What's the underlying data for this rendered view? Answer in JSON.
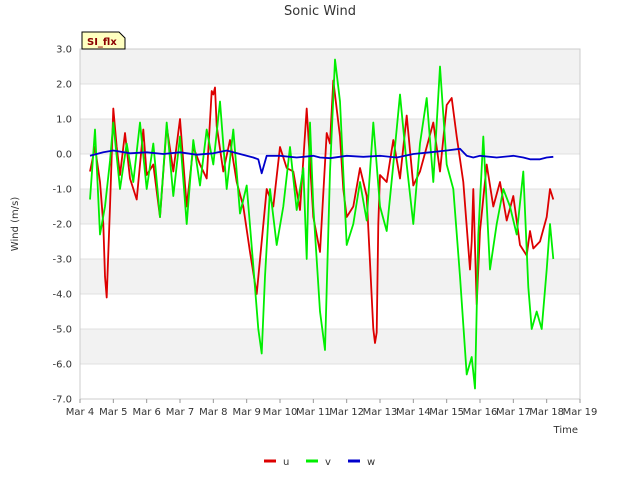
{
  "chart_data": {
    "type": "line",
    "title": "Sonic Wind",
    "xlabel": "Time",
    "ylabel": "Wind (m/s)",
    "badge": "SI_flx",
    "ylim": [
      -7.0,
      3.0
    ],
    "xlim": [
      0,
      15
    ],
    "grid": "horizontal bands",
    "legend_position": "bottom-center",
    "x_ticks": [
      {
        "v": 0,
        "label": "Mar 4"
      },
      {
        "v": 1,
        "label": "Mar 5"
      },
      {
        "v": 2,
        "label": "Mar 6"
      },
      {
        "v": 3,
        "label": "Mar 7"
      },
      {
        "v": 4,
        "label": "Mar 8"
      },
      {
        "v": 5,
        "label": "Mar 9"
      },
      {
        "v": 6,
        "label": "Mar 10"
      },
      {
        "v": 7,
        "label": "Mar 11"
      },
      {
        "v": 8,
        "label": "Mar 12"
      },
      {
        "v": 9,
        "label": "Mar 13"
      },
      {
        "v": 10,
        "label": "Mar 14"
      },
      {
        "v": 11,
        "label": "Mar 15"
      },
      {
        "v": 12,
        "label": "Mar 16"
      },
      {
        "v": 13,
        "label": "Mar 17"
      },
      {
        "v": 14,
        "label": "Mar 18"
      },
      {
        "v": 15,
        "label": "Mar 19"
      }
    ],
    "y_ticks": [
      {
        "v": 3,
        "label": "3.0"
      },
      {
        "v": 2,
        "label": "2.0"
      },
      {
        "v": 1,
        "label": "1.0"
      },
      {
        "v": 0,
        "label": "0.0"
      },
      {
        "v": -1,
        "label": "-1.0"
      },
      {
        "v": -2,
        "label": "-2.0"
      },
      {
        "v": -3,
        "label": "-3.0"
      },
      {
        "v": -4,
        "label": "-4.0"
      },
      {
        "v": -5,
        "label": "-5.0"
      },
      {
        "v": -6,
        "label": "-6.0"
      },
      {
        "v": -7,
        "label": "-7.0"
      }
    ],
    "series": [
      {
        "name": "u",
        "color": "#dd0000",
        "x": [
          0.3,
          0.45,
          0.6,
          0.7,
          0.75,
          0.8,
          0.9,
          1.0,
          1.1,
          1.2,
          1.35,
          1.5,
          1.7,
          1.9,
          2.0,
          2.2,
          2.4,
          2.6,
          2.8,
          3.0,
          3.2,
          3.4,
          3.6,
          3.8,
          3.95,
          4.0,
          4.05,
          4.1,
          4.3,
          4.5,
          4.7,
          4.9,
          5.1,
          5.3,
          5.45,
          5.6,
          5.8,
          6.0,
          6.2,
          6.4,
          6.6,
          6.8,
          7.0,
          7.2,
          7.4,
          7.5,
          7.6,
          7.8,
          7.9,
          8.0,
          8.2,
          8.4,
          8.6,
          8.8,
          8.85,
          8.9,
          8.95,
          9.0,
          9.2,
          9.4,
          9.6,
          9.8,
          10.0,
          10.2,
          10.4,
          10.6,
          10.8,
          11.0,
          11.15,
          11.3,
          11.5,
          11.7,
          11.75,
          11.8,
          11.9,
          12.0,
          12.2,
          12.4,
          12.6,
          12.8,
          13.0,
          13.2,
          13.4,
          13.5,
          13.6,
          13.8,
          14.0,
          14.1,
          14.2
        ],
        "y": [
          -0.5,
          0.2,
          -0.8,
          -2.0,
          -3.5,
          -4.1,
          -1.5,
          1.3,
          0.2,
          -0.6,
          0.6,
          -0.7,
          -1.3,
          0.7,
          -0.6,
          -0.3,
          -1.8,
          0.8,
          -0.5,
          1.0,
          -1.5,
          0.2,
          -0.3,
          -0.7,
          1.8,
          1.7,
          1.9,
          0.8,
          -0.5,
          0.4,
          -0.8,
          -1.5,
          -2.8,
          -4.0,
          -2.5,
          -1.0,
          -1.5,
          0.2,
          -0.4,
          -0.5,
          -1.6,
          1.3,
          -1.8,
          -2.8,
          0.6,
          0.3,
          2.1,
          0.5,
          -1.0,
          -1.8,
          -1.5,
          -0.4,
          -1.2,
          -5.0,
          -5.4,
          -5.1,
          -2.0,
          -0.6,
          -0.8,
          0.4,
          -0.7,
          1.1,
          -0.9,
          -0.5,
          0.2,
          0.9,
          -0.5,
          1.4,
          1.6,
          0.5,
          -0.8,
          -3.3,
          -2.5,
          -1.0,
          -4.3,
          -2.2,
          -0.3,
          -1.5,
          -0.8,
          -1.9,
          -1.2,
          -2.6,
          -2.9,
          -2.2,
          -2.7,
          -2.5,
          -1.8,
          -1.0,
          -1.3
        ]
      },
      {
        "name": "v",
        "color": "#00ee00",
        "x": [
          0.3,
          0.45,
          0.6,
          0.75,
          0.9,
          1.0,
          1.2,
          1.4,
          1.6,
          1.8,
          2.0,
          2.2,
          2.4,
          2.6,
          2.8,
          3.0,
          3.2,
          3.4,
          3.6,
          3.8,
          4.0,
          4.2,
          4.4,
          4.6,
          4.8,
          5.0,
          5.2,
          5.35,
          5.45,
          5.55,
          5.7,
          5.9,
          6.1,
          6.3,
          6.5,
          6.7,
          6.8,
          6.9,
          7.0,
          7.2,
          7.35,
          7.5,
          7.65,
          7.8,
          8.0,
          8.2,
          8.4,
          8.6,
          8.8,
          9.0,
          9.2,
          9.4,
          9.6,
          9.8,
          10.0,
          10.2,
          10.4,
          10.6,
          10.8,
          11.0,
          11.2,
          11.4,
          11.6,
          11.75,
          11.85,
          11.95,
          12.1,
          12.3,
          12.5,
          12.7,
          12.9,
          13.1,
          13.3,
          13.45,
          13.55,
          13.7,
          13.85,
          14.0,
          14.1,
          14.2
        ],
        "y": [
          -1.3,
          0.7,
          -2.3,
          -1.5,
          -0.2,
          0.9,
          -1.0,
          0.3,
          -0.8,
          0.9,
          -1.0,
          0.3,
          -1.8,
          0.9,
          -1.2,
          0.5,
          -2.0,
          0.4,
          -0.9,
          0.7,
          -0.3,
          1.5,
          -1.0,
          0.7,
          -1.7,
          -0.9,
          -3.2,
          -5.0,
          -5.7,
          -3.5,
          -1.0,
          -2.6,
          -1.5,
          0.2,
          -1.6,
          -0.4,
          -3.0,
          0.9,
          -1.5,
          -4.5,
          -5.6,
          -0.5,
          2.7,
          1.5,
          -2.6,
          -2.0,
          -0.8,
          -1.9,
          0.9,
          -1.5,
          -2.2,
          -0.3,
          1.7,
          -0.3,
          -2.0,
          0.3,
          1.6,
          -0.8,
          2.5,
          -0.3,
          -1.0,
          -3.5,
          -6.3,
          -5.8,
          -6.7,
          -2.3,
          0.5,
          -3.3,
          -2.0,
          -1.0,
          -1.5,
          -2.3,
          -0.5,
          -3.8,
          -5.0,
          -4.5,
          -5.0,
          -3.3,
          -2.0,
          -3.0
        ]
      },
      {
        "name": "w",
        "color": "#0000cc",
        "x": [
          0.3,
          0.7,
          1.0,
          1.5,
          2.0,
          2.5,
          3.0,
          3.5,
          4.0,
          4.4,
          4.8,
          5.2,
          5.35,
          5.45,
          5.6,
          6.0,
          6.5,
          7.0,
          7.2,
          7.5,
          8.0,
          8.5,
          9.0,
          9.5,
          10.0,
          10.5,
          11.0,
          11.4,
          11.6,
          11.8,
          12.0,
          12.5,
          13.0,
          13.3,
          13.5,
          13.8,
          14.0,
          14.2
        ],
        "y": [
          -0.05,
          0.05,
          0.1,
          0.02,
          0.05,
          0.0,
          0.05,
          -0.02,
          0.02,
          0.1,
          0.0,
          -0.1,
          -0.15,
          -0.55,
          -0.05,
          -0.05,
          -0.1,
          -0.05,
          -0.1,
          -0.12,
          -0.05,
          -0.08,
          -0.05,
          -0.1,
          0.0,
          0.05,
          0.1,
          0.15,
          -0.05,
          -0.1,
          -0.05,
          -0.1,
          -0.05,
          -0.1,
          -0.15,
          -0.15,
          -0.1,
          -0.08
        ]
      }
    ]
  }
}
